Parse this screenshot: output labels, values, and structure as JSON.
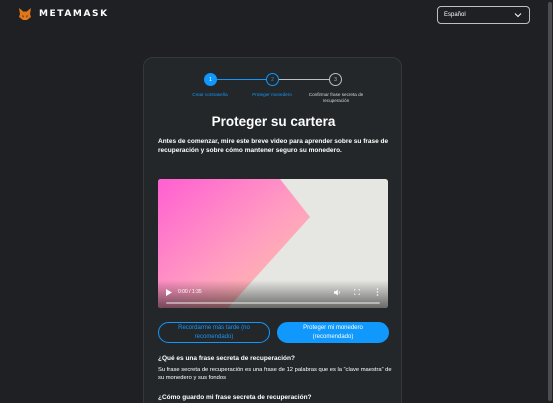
{
  "header": {
    "brand": "METAMASK",
    "language_selected": "Español"
  },
  "stepper": {
    "steps": [
      {
        "number": "1",
        "label": "Crear contraseña",
        "state": "complete"
      },
      {
        "number": "2",
        "label": "Proteger monedero",
        "state": "current"
      },
      {
        "number": "3",
        "label": "Confirmar frase secreta de recuperación",
        "state": "pending"
      }
    ]
  },
  "main": {
    "title": "Proteger su cartera",
    "intro": "Antes de comenzar, mire este breve video para aprender sobre su frase de recuperación y sobre cómo mantener seguro su monedero."
  },
  "video": {
    "time": "0:00 / 1:35",
    "progress": 0
  },
  "buttons": {
    "remind_later": "Recordarme más tarde (no recomendado)",
    "secure_wallet": "Proteger mi monedero (recomendado)"
  },
  "faq": {
    "q1": "¿Qué es una frase secreta de recuperación?",
    "a1": "Su frase secreta de recuperación es una frase de 12 palabras que es la “clave maestra” de su monedero y sus fondos",
    "q2": "¿Cómo guardo mi frase secreta de recuperación?"
  },
  "colors": {
    "accent": "#1098fc",
    "background": "#1e2024",
    "card": "#24272a"
  },
  "icons": {
    "logo": "metamask-fox-icon",
    "language_chevron": "chevron-down-icon",
    "play": "play-icon",
    "volume": "volume-icon",
    "fullscreen": "fullscreen-icon",
    "more": "more-vertical-icon"
  }
}
